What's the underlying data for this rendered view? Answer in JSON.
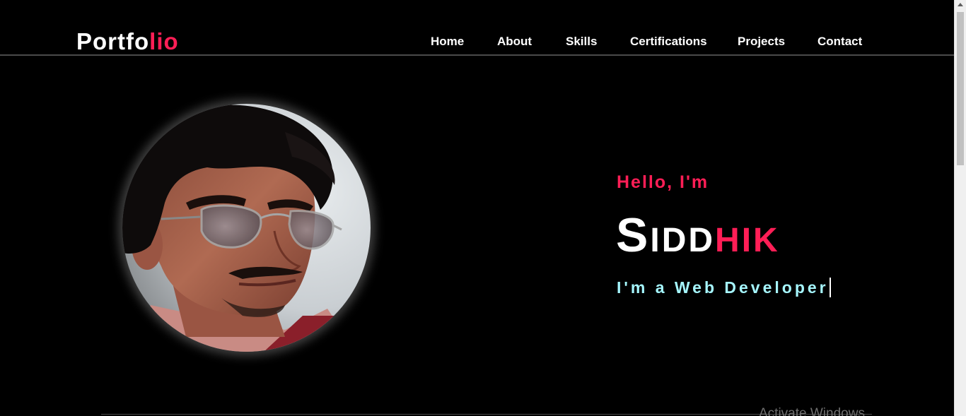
{
  "brand": {
    "logo_main": "Portfo",
    "logo_accent": "lio",
    "accent_color": "#ff1e56"
  },
  "nav": {
    "items": [
      {
        "label": "Home"
      },
      {
        "label": "About"
      },
      {
        "label": "Skills"
      },
      {
        "label": "Certifications"
      },
      {
        "label": "Projects"
      },
      {
        "label": "Contact"
      }
    ]
  },
  "hero": {
    "greeting": "Hello, I'm",
    "name_first": "Sidd",
    "name_accent": "hik",
    "role": "I'm a Web Developer",
    "role_color": "#a6f7ff",
    "avatar": "profile-photo"
  },
  "system": {
    "watermark": "Activate Windows"
  }
}
